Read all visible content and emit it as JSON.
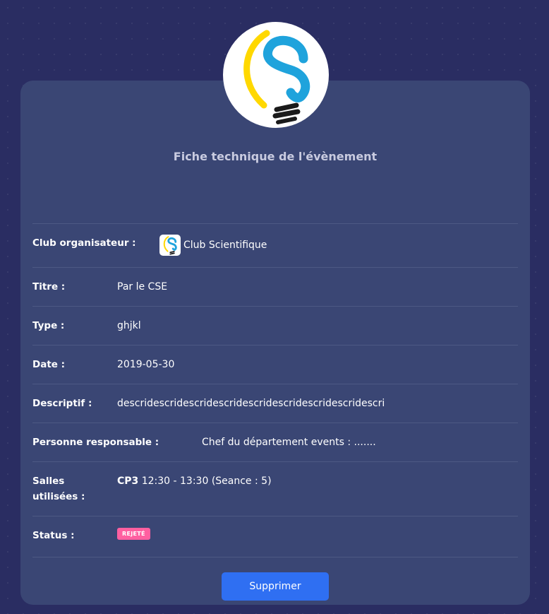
{
  "header": {
    "title": "Fiche technique de l'évènement"
  },
  "fields": {
    "club_label": "Club organisateur :",
    "club_value": "Club Scientifique",
    "titre_label": "Titre :",
    "titre_value": "Par le CSE",
    "type_label": "Type :",
    "type_value": "ghjkl",
    "date_label": "Date :",
    "date_value": "2019-05-30",
    "desc_label": "Descriptif :",
    "desc_value": "descridescridescridescridescridescridescridescridescri",
    "resp_label": "Personne responsable :",
    "resp_value": "Chef du département events : .......",
    "salles_label_1": "Salles",
    "salles_label_2": "utilisées :",
    "salle_room": "CP3",
    "salle_detail": " 12:30 - 13:30 (Seance : 5)",
    "status_label": "Status :",
    "status_badge": "REJETÉ"
  },
  "actions": {
    "delete_label": "Supprimer"
  },
  "colors": {
    "background": "#2a2d62",
    "card": "#3a4674",
    "badge": "#ff5fa0",
    "button": "#2f6ff2",
    "logo_blue": "#1fa3dc",
    "logo_yellow": "#ffd800"
  },
  "icons": {
    "logo": "lightbulb-s-logo-icon",
    "club": "club-logo-icon"
  }
}
